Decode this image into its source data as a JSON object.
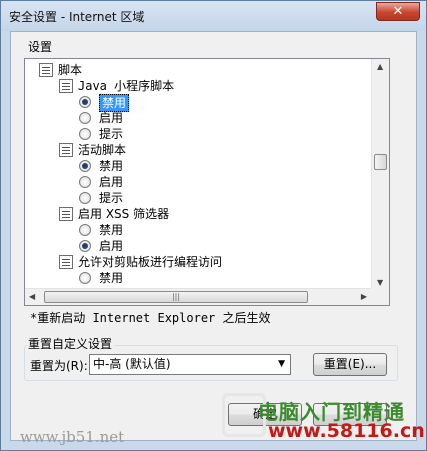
{
  "window": {
    "title": "安全设置 - Internet 区域",
    "close_glyph": "✕"
  },
  "settings_label": "设置",
  "tree": {
    "items": [
      {
        "kind": "category",
        "label": "脚本"
      },
      {
        "kind": "category",
        "label": "Java 小程序脚本"
      },
      {
        "kind": "option",
        "label": "禁用",
        "checked": true,
        "selected": true
      },
      {
        "kind": "option",
        "label": "启用",
        "checked": false
      },
      {
        "kind": "option",
        "label": "提示",
        "checked": false
      },
      {
        "kind": "category",
        "label": "活动脚本"
      },
      {
        "kind": "option",
        "label": "禁用",
        "checked": true
      },
      {
        "kind": "option",
        "label": "启用",
        "checked": false
      },
      {
        "kind": "option",
        "label": "提示",
        "checked": false
      },
      {
        "kind": "category",
        "label": "启用 XSS 筛选器"
      },
      {
        "kind": "option",
        "label": "禁用",
        "checked": false
      },
      {
        "kind": "option",
        "label": "启用",
        "checked": true
      },
      {
        "kind": "category",
        "label": "允许对剪贴板进行编程访问"
      },
      {
        "kind": "option",
        "label": "禁用",
        "checked": false
      }
    ]
  },
  "restart_note": "*重新启动 Internet Explorer 之后生效",
  "reset_group": {
    "title": "重置自定义设置",
    "reset_to_label": "重置为(R):",
    "selected_level": "中-高 (默认值)",
    "reset_button": "重置(E)..."
  },
  "buttons": {
    "ok": "确定"
  },
  "watermarks": {
    "left": "www.jb51.net",
    "right_top": "电脑入门到精通",
    "right_bottom": "www.58116.cn"
  }
}
